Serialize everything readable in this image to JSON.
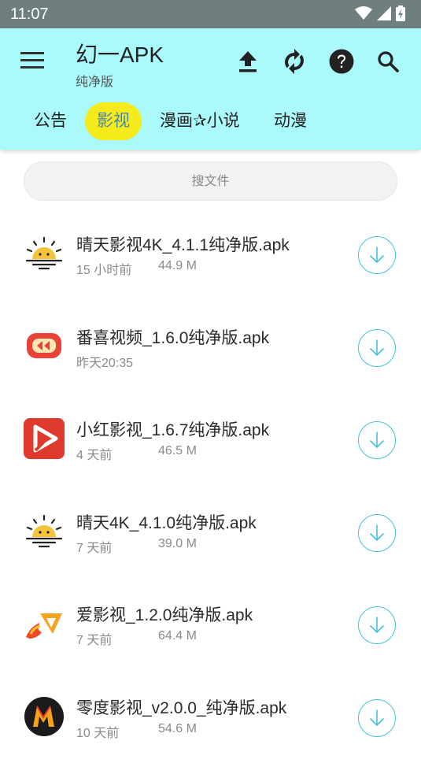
{
  "status_bar": {
    "time": "11:07"
  },
  "app": {
    "title": "幻一APK",
    "subtitle": "纯净版"
  },
  "tabs": [
    {
      "label": "公告",
      "active": false
    },
    {
      "label": "影视",
      "active": true
    },
    {
      "label": "漫画✰小说",
      "active": false
    },
    {
      "label": "动漫",
      "active": false
    }
  ],
  "search": {
    "placeholder": "搜文件"
  },
  "files": [
    {
      "name": "晴天影视4K_4.1.1纯净版.apk",
      "time": "15 小时前",
      "size": "44.9 M",
      "icon": "sun-icon"
    },
    {
      "name": "番喜视频_1.6.0纯净版.apk",
      "time": "昨天20:35",
      "size": "",
      "icon": "fanxi-play-icon"
    },
    {
      "name": "小红影视_1.6.7纯净版.apk",
      "time": "4 天前",
      "size": "46.5 M",
      "icon": "red-play-icon"
    },
    {
      "name": "晴天4K_4.1.0纯净版.apk",
      "time": "7 天前",
      "size": "39.0 M",
      "icon": "sun-icon"
    },
    {
      "name": "爱影视_1.2.0纯净版.apk",
      "time": "7 天前",
      "size": "64.4 M",
      "icon": "flame-play-icon"
    },
    {
      "name": "零度影视_v2.0.0_纯净版.apk",
      "time": "10 天前",
      "size": "54.6 M",
      "icon": "m-logo-icon"
    }
  ],
  "colors": {
    "appbar": "#aaf9fb",
    "active_tab_bg": "#f5ea1a",
    "active_tab_text": "#4a88a8",
    "download_accent": "#46c0e0",
    "statusbar": "#6f7f7f"
  }
}
